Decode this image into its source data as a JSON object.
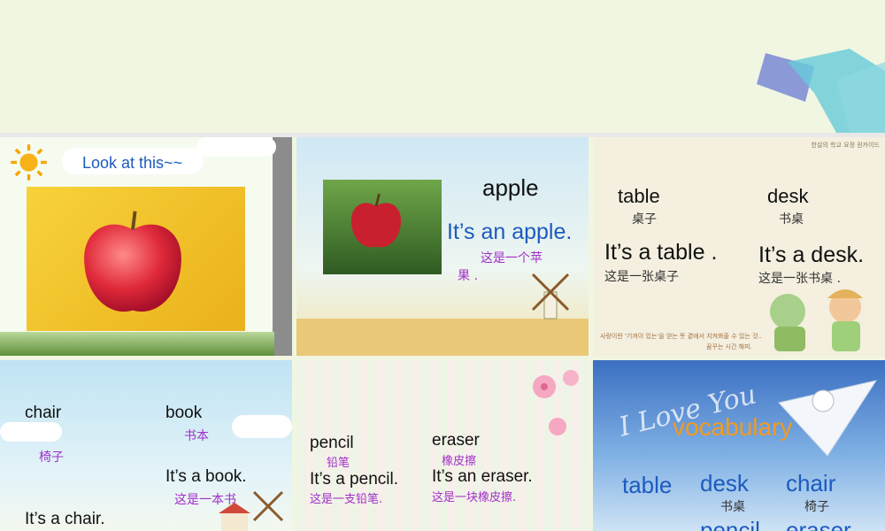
{
  "slides": {
    "s1": {
      "caption": "Look at this~~"
    },
    "s2": {
      "word": "apple",
      "sentence": "It’s an apple.",
      "cn_line1": "这是一个苹",
      "cn_line2": "果 ."
    },
    "s3": {
      "w1": "table",
      "w1_cn": "桌子",
      "w2": "desk",
      "w2_cn": "书桌",
      "s1": "It’s a table .",
      "s1_cn": "这是一张桌子",
      "s2": "It’s a desk.",
      "s2_cn": "这是一张书桌 .",
      "footer1": "사랑이란 '기꺼이 있는'을 얻는 뜻 곁에서 지켜봐줄 수 있는 것..",
      "footer2": "꿈꾸는 시간 해피.",
      "corner": "한설의 학교 요정 원카이드"
    },
    "s4": {
      "w1": "chair",
      "w1_cn": "椅子",
      "w2": "book",
      "w2_cn": "书本",
      "s2": "It’s a book.",
      "s2_cn": "这是一本书",
      "s1": "It’s a chair."
    },
    "s5": {
      "w1": "pencil",
      "w1_cn": "铅笔",
      "w2": "eraser",
      "w2_cn": "橡皮擦",
      "s1": "It’s a pencil.",
      "s1_cn": "这是一支铅笔.",
      "s2": "It’s an eraser.",
      "s2_cn": "这是一块橡皮擦."
    },
    "s6": {
      "script": "I Love You",
      "title": "vocabulary",
      "w1": "table",
      "w2": "desk",
      "w2_cn": "书桌",
      "w3": "chair",
      "w3_cn": "椅子",
      "w4": "pencil",
      "w5": "eraser"
    }
  },
  "colors": {
    "blue": "#1c5bbf",
    "purple": "#a12fc9",
    "orange": "#f39a1e"
  }
}
